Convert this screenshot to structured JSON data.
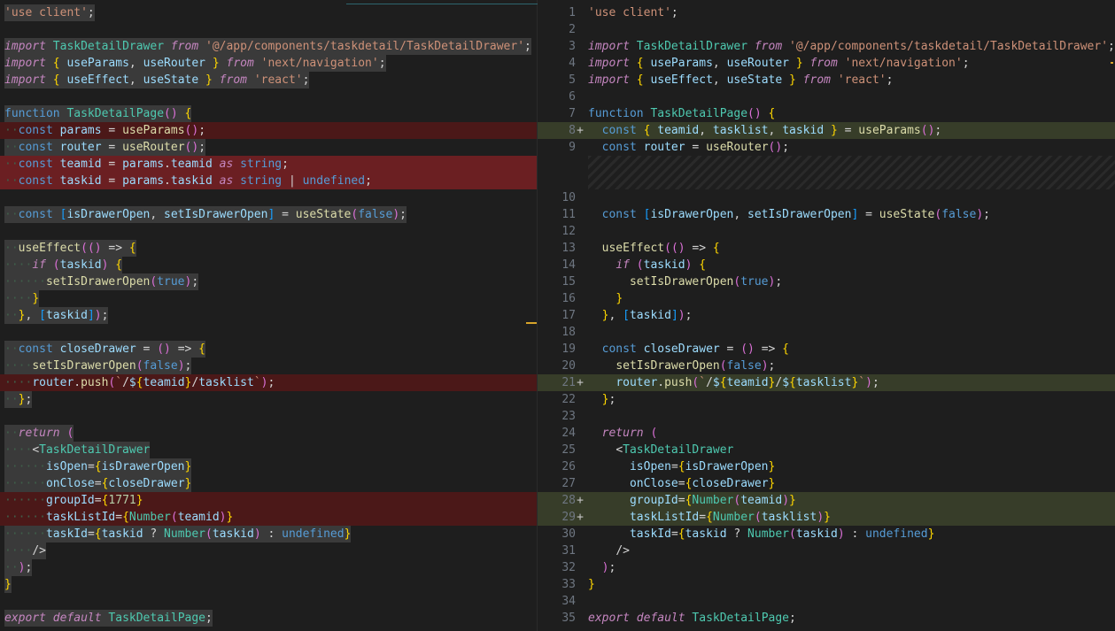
{
  "left": {
    "lines": [
      {
        "text": "'use client';",
        "bg": "hl"
      },
      {
        "text": "",
        "bg": ""
      },
      {
        "text": "import TaskDetailDrawer from '@/app/components/taskdetail/TaskDetailDrawer';",
        "bg": "hl"
      },
      {
        "text": "import { useParams, useRouter } from 'next/navigation';",
        "bg": "hl"
      },
      {
        "text": "import { useEffect, useState } from 'react';",
        "bg": "hl"
      },
      {
        "text": "",
        "bg": ""
      },
      {
        "text": "function TaskDetailPage() {",
        "bg": "hl"
      },
      {
        "text": "··const params = useParams();",
        "bg": "del"
      },
      {
        "text": "··const router = useRouter();",
        "bg": "hl"
      },
      {
        "text": "··const teamid = params.teamid as string;",
        "bg": "delstrong"
      },
      {
        "text": "··const taskid = params.taskid as string | undefined;",
        "bg": "delstrong"
      },
      {
        "text": "",
        "bg": ""
      },
      {
        "text": "··const [isDrawerOpen, setIsDrawerOpen] = useState(false);",
        "bg": "hl"
      },
      {
        "text": "",
        "bg": ""
      },
      {
        "text": "··useEffect(() => {",
        "bg": "hl"
      },
      {
        "text": "····if (taskid) {",
        "bg": "hl"
      },
      {
        "text": "······setIsDrawerOpen(true);",
        "bg": "hl"
      },
      {
        "text": "····}",
        "bg": "hl"
      },
      {
        "text": "··}, [taskid]);",
        "bg": "hl"
      },
      {
        "text": "",
        "bg": ""
      },
      {
        "text": "··const closeDrawer = () => {",
        "bg": "hl"
      },
      {
        "text": "····setIsDrawerOpen(false);",
        "bg": "hl"
      },
      {
        "text": "····router.push(`/${teamid}/tasklist`);",
        "bg": "del"
      },
      {
        "text": "··};",
        "bg": "hl"
      },
      {
        "text": "",
        "bg": ""
      },
      {
        "text": "··return (",
        "bg": "hl"
      },
      {
        "text": "····<TaskDetailDrawer",
        "bg": "hl"
      },
      {
        "text": "······isOpen={isDrawerOpen}",
        "bg": "hl"
      },
      {
        "text": "······onClose={closeDrawer}",
        "bg": "hl"
      },
      {
        "text": "······groupId={1771}",
        "bg": "del"
      },
      {
        "text": "······taskListId={Number(teamid)}",
        "bg": "del"
      },
      {
        "text": "······taskId={taskid ? Number(taskid) : undefined}",
        "bg": "hl"
      },
      {
        "text": "····/>",
        "bg": "hl"
      },
      {
        "text": "··);",
        "bg": "hl"
      },
      {
        "text": "}",
        "bg": "hl"
      },
      {
        "text": "",
        "bg": ""
      },
      {
        "text": "export default TaskDetailPage;",
        "bg": "hl"
      }
    ]
  },
  "right": {
    "lines": [
      {
        "n": "1",
        "text": "'use client';",
        "bg": ""
      },
      {
        "n": "2",
        "text": "",
        "bg": ""
      },
      {
        "n": "3",
        "text": "import TaskDetailDrawer from '@/app/components/taskdetail/TaskDetailDrawer';",
        "bg": ""
      },
      {
        "n": "4",
        "text": "import { useParams, useRouter } from 'next/navigation';",
        "bg": ""
      },
      {
        "n": "5",
        "text": "import { useEffect, useState } from 'react';",
        "bg": ""
      },
      {
        "n": "6",
        "text": "",
        "bg": ""
      },
      {
        "n": "7",
        "text": "function TaskDetailPage() {",
        "bg": ""
      },
      {
        "n": "8",
        "text": "  const { teamid, tasklist, taskid } = useParams();",
        "bg": "add",
        "plus": "+"
      },
      {
        "n": "9",
        "text": "  const router = useRouter();",
        "bg": ""
      },
      {
        "n": "",
        "text": "",
        "bg": "hatch"
      },
      {
        "n": "",
        "text": "",
        "bg": "hatch"
      },
      {
        "n": "10",
        "text": "",
        "bg": ""
      },
      {
        "n": "11",
        "text": "  const [isDrawerOpen, setIsDrawerOpen] = useState(false);",
        "bg": ""
      },
      {
        "n": "12",
        "text": "",
        "bg": ""
      },
      {
        "n": "13",
        "text": "  useEffect(() => {",
        "bg": ""
      },
      {
        "n": "14",
        "text": "    if (taskid) {",
        "bg": ""
      },
      {
        "n": "15",
        "text": "      setIsDrawerOpen(true);",
        "bg": ""
      },
      {
        "n": "16",
        "text": "    }",
        "bg": ""
      },
      {
        "n": "17",
        "text": "  }, [taskid]);",
        "bg": ""
      },
      {
        "n": "18",
        "text": "",
        "bg": ""
      },
      {
        "n": "19",
        "text": "  const closeDrawer = () => {",
        "bg": ""
      },
      {
        "n": "20",
        "text": "    setIsDrawerOpen(false);",
        "bg": ""
      },
      {
        "n": "21",
        "text": "    router.push(`/${teamid}/${tasklist}`);",
        "bg": "add",
        "plus": "+"
      },
      {
        "n": "22",
        "text": "  };",
        "bg": ""
      },
      {
        "n": "23",
        "text": "",
        "bg": ""
      },
      {
        "n": "24",
        "text": "  return (",
        "bg": ""
      },
      {
        "n": "25",
        "text": "    <TaskDetailDrawer",
        "bg": ""
      },
      {
        "n": "26",
        "text": "      isOpen={isDrawerOpen}",
        "bg": ""
      },
      {
        "n": "27",
        "text": "      onClose={closeDrawer}",
        "bg": ""
      },
      {
        "n": "28",
        "text": "      groupId={Number(teamid)}",
        "bg": "add",
        "plus": "+"
      },
      {
        "n": "29",
        "text": "      taskListId={Number(tasklist)}",
        "bg": "add",
        "plus": "+"
      },
      {
        "n": "30",
        "text": "      taskId={taskid ? Number(taskid) : undefined}",
        "bg": ""
      },
      {
        "n": "31",
        "text": "    />",
        "bg": ""
      },
      {
        "n": "32",
        "text": "  );",
        "bg": ""
      },
      {
        "n": "33",
        "text": "}",
        "bg": ""
      },
      {
        "n": "34",
        "text": "",
        "bg": ""
      },
      {
        "n": "35",
        "text": "export default TaskDetailPage;",
        "bg": ""
      }
    ]
  }
}
